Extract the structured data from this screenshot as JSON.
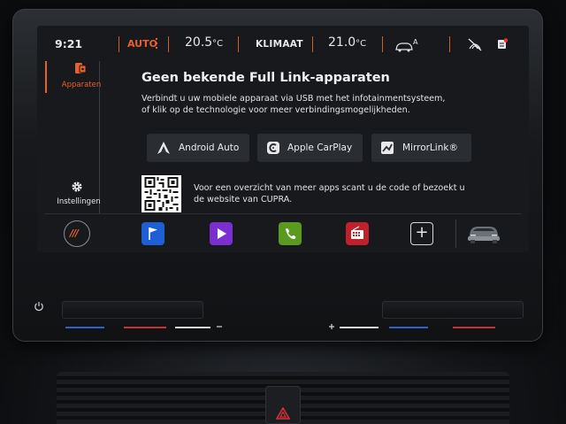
{
  "status_bar": {
    "time": "9:21",
    "climate_mode": "AUTO",
    "temp_left": "20.5",
    "temp_unit": "°C",
    "climate_label": "KLIMAAT",
    "temp_right": "21.0",
    "car_mode_letter": "A"
  },
  "sidebar": {
    "items": [
      {
        "label": "Apparaten",
        "icon": "phone-link-icon",
        "active": true
      },
      {
        "label": "Instellingen",
        "icon": "gear-icon",
        "active": false
      }
    ]
  },
  "main": {
    "title": "Geen bekende Full Link-apparaten",
    "description": "Verbindt u uw mobiele apparaat via USB met het infotainmentsysteem, of klik op de technologie voor meer verbindingsmogelijkheden.",
    "buttons": [
      {
        "label": "Android Auto",
        "icon": "android-auto-icon"
      },
      {
        "label": "Apple CarPlay",
        "icon": "carplay-icon"
      },
      {
        "label": "MirrorLink®",
        "icon": "mirrorlink-icon"
      }
    ],
    "qr_text": "Voor een overzicht van meer apps scant u de code of bezoekt u de website van CUPRA."
  },
  "dock": {
    "cupra_label": "///",
    "apps": [
      {
        "name": "navigation",
        "icon": "flag-icon",
        "color": "#1f5fd6"
      },
      {
        "name": "media",
        "icon": "play-icon",
        "color": "#7b2fd0"
      },
      {
        "name": "phone",
        "icon": "phone-icon",
        "color": "#5a9a1e"
      },
      {
        "name": "radio",
        "icon": "radio-icon",
        "color": "#c0202a"
      }
    ],
    "add_label": "+"
  },
  "colors": {
    "accent": "#e8612a",
    "screen_bg": "#17191d",
    "button_bg": "#2a2d32"
  }
}
